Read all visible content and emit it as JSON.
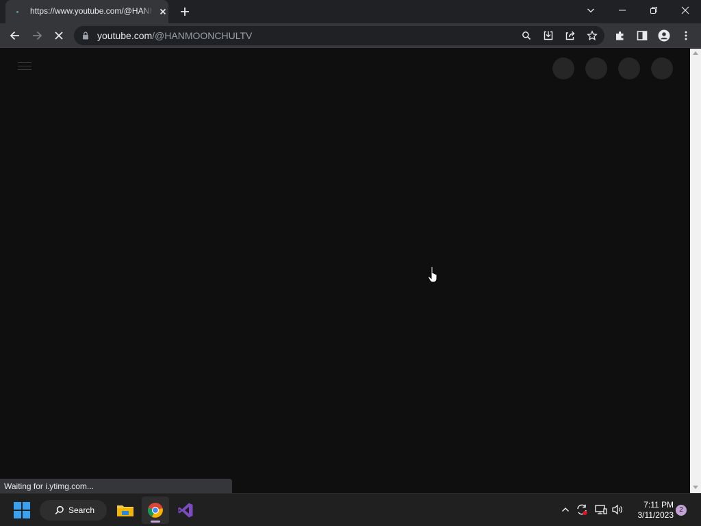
{
  "browser": {
    "tab": {
      "title": "https://www.youtube.com/@HANMOONCHULTV"
    },
    "address_bar": {
      "host": "youtube.com",
      "path": "/@HANMOONCHULTV"
    },
    "status_text": "Waiting for i.ytimg.com..."
  },
  "taskbar": {
    "search_label": "Search",
    "time": "7:11 PM",
    "date": "3/11/2023",
    "notification_count": "2"
  },
  "icons": {
    "tab": [
      "page-favicon",
      "tab-close-icon",
      "new-tab-icon"
    ],
    "window": [
      "tab-search-chevron-icon",
      "minimize-icon",
      "restore-icon",
      "close-window-icon"
    ],
    "toolbar": [
      "back-arrow-icon",
      "forward-arrow-icon",
      "stop-loading-icon",
      "lock-icon",
      "zoom-search-icon",
      "install-app-icon",
      "share-icon",
      "bookmark-star-icon",
      "extensions-puzzle-icon",
      "side-panel-icon",
      "profile-icon",
      "menu-kebab-icon"
    ],
    "taskbar": [
      "windows-start-icon",
      "search-magnifier-icon",
      "file-explorer-icon",
      "chrome-icon",
      "visual-studio-icon",
      "show-hidden-icons-chevron-icon",
      "sync-icon",
      "network-icon",
      "volume-icon"
    ]
  },
  "colors": {
    "page_background": "#0f0f0f",
    "chrome_frame": "#202124",
    "chrome_toolbar": "#35363a",
    "skeleton": "#262626",
    "taskbar": "#202020",
    "accent": "#c4a2d6"
  }
}
